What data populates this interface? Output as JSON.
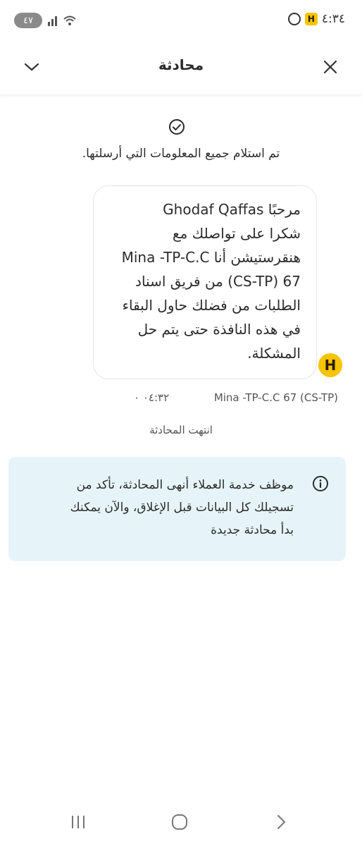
{
  "status_bar": {
    "time": "٤:٣٤",
    "battery": "٤٧",
    "badge_letter": "H"
  },
  "header": {
    "title": "محادثة"
  },
  "chat": {
    "receipt_text": "تم استلام جميع المعلومات التي أرسلتها.",
    "message_text": "مرحبًا Ghodaf Qaffas\nشكرا على تواصلك مع\nهنقرستيشن أنا Mina -TP-C.C\n67 (CS-TP) من فريق اسناد\nالطلبات من فضلك حاول البقاء\nفي هذه النافذة حتى يتم حل\nالمشكلة.",
    "avatar_letter": "H",
    "sender": "Mina -TP-C.C 67 (CS-TP)",
    "time": "٠٤:٣٢ ٠",
    "ended_label": "انتهت المحادثة"
  },
  "info_banner": {
    "text": "موظف خدمة العملاء أنهى المحادثة، تأكد من تسجيلك كل البيانات قبل الإغلاق، والآن يمكنك بدأ محادثة جديدة"
  },
  "colors": {
    "brand_yellow": "#f6c400",
    "info_background": "#e6f4f9"
  },
  "icons": [
    "chevron-down-icon",
    "close-icon",
    "check-circle-icon",
    "info-icon",
    "recents-icon",
    "home-icon",
    "back-icon"
  ]
}
